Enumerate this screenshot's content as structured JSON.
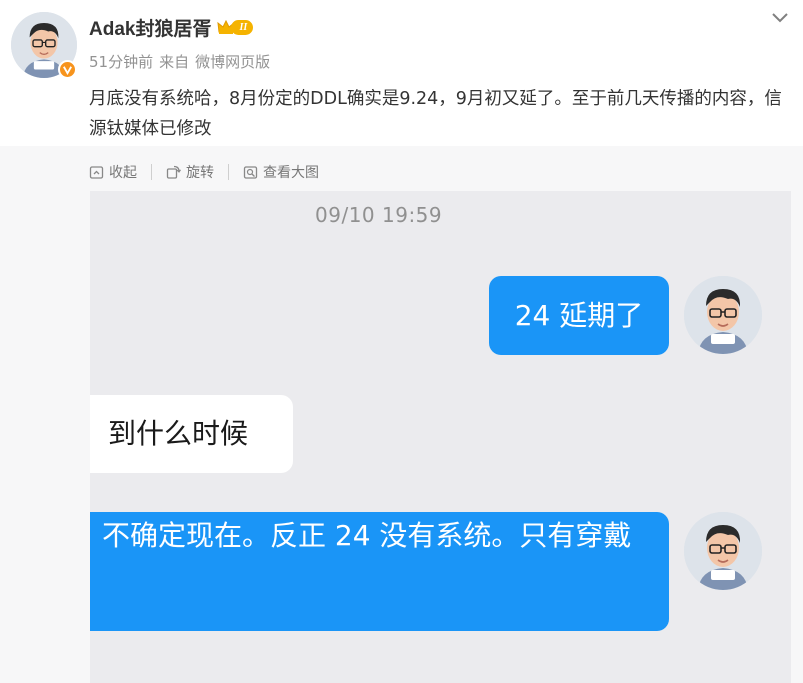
{
  "post": {
    "author": "Adak封狼居胥",
    "level": "II",
    "time": "51分钟前",
    "source_prefix": "来自",
    "source": "微博网页版",
    "text": "月底没有系统哈，8月份定的DDL确实是9.24，9月初又延了。至于前几天传播的内容，信源钛媒体已修改"
  },
  "toolbar": {
    "collapse_label": "收起",
    "rotate_label": "旋转",
    "view_large_label": "查看大图"
  },
  "chat": {
    "timestamp": "09/10 19:59",
    "messages": [
      {
        "side": "right",
        "text": "24 延期了"
      },
      {
        "side": "left",
        "text": "到什么时候"
      },
      {
        "side": "right",
        "text": "不确定现在。反正 24 没有系统。只有穿戴"
      }
    ]
  },
  "colors": {
    "accent_blue": "#1a95f7",
    "verified_orange": "#f7941d",
    "level_gold": "#f5b300"
  },
  "icons": [
    "avatar-cartoon",
    "verified-v-icon",
    "crown-icon",
    "chevron-down-icon",
    "collapse-icon",
    "rotate-icon",
    "view-large-icon"
  ]
}
